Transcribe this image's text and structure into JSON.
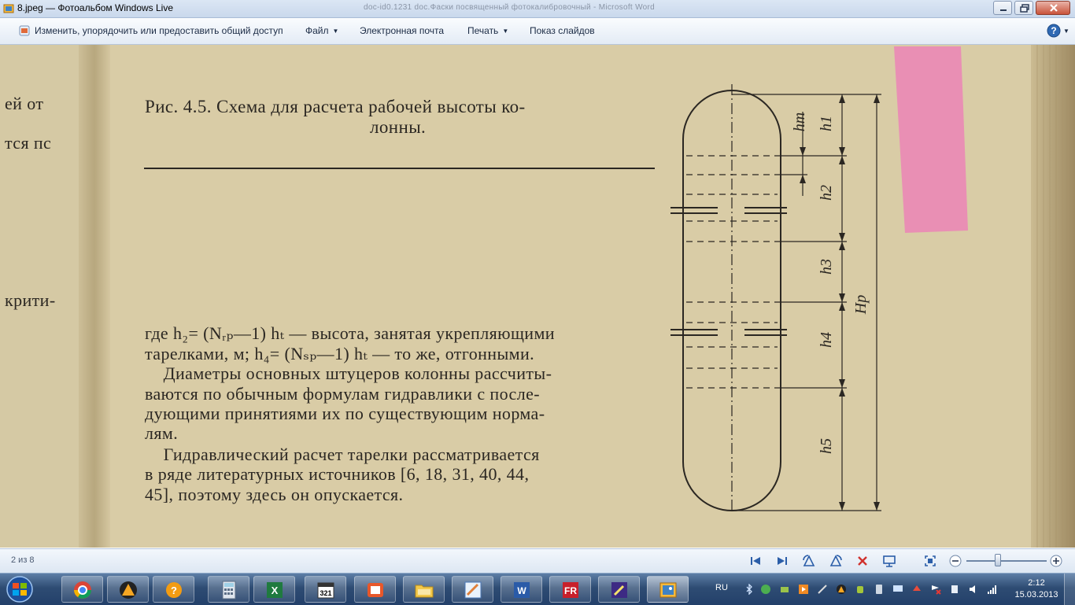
{
  "window": {
    "title": "8.jpeg — Фотоальбом Windows Live",
    "background_title": "doc-id0.1231 doc.Фаски посвященный фотокалибровочный - Microsoft Word"
  },
  "commandbar": {
    "organize": "Изменить, упорядочить или предоставить общий доступ",
    "file": "Файл",
    "email": "Электронная почта",
    "print": "Печать",
    "slideshow": "Показ слайдов"
  },
  "page": {
    "left_fragments": [
      "ей от",
      "тся пс",
      "крити-"
    ],
    "caption_line1": "Рис.  4.5.  Схема  для  расчета  рабочей  высоты  ко-",
    "caption_line2": "лонны.",
    "body": [
      "где h₂= (Nᵣₚ—1) hₜ — высота, занятая укрепляющими",
      "тарелками, м; h₄= (Nₛₚ—1) hₜ — то же, отгонными.",
      "    Диаметры основных штуцеров колонны рассчиты-",
      "ваются по обычным формулам гидравлики с после-",
      "дующими принятиями их по существующим норма-",
      "лям.",
      "    Гидравлический расчет тарелки рассматривается",
      "в ряде литературных источников [6, 18, 31, 40, 44,",
      "45], поэтому здесь он опускается."
    ],
    "diagram_labels": {
      "ht": "hт",
      "h1": "h1",
      "h2": "h2",
      "h3": "h3",
      "h4": "h4",
      "h5": "h5",
      "Hp": "Hp"
    }
  },
  "viewer": {
    "counter": "2 из 8"
  },
  "taskbar": {
    "language": "RU",
    "time": "2:12",
    "date": "15.03.2013"
  },
  "colors": {
    "paper": "#d8caa3",
    "bookmark": "#e98fb4",
    "ink": "#2b2722",
    "taskbar": "#2e4c73"
  }
}
